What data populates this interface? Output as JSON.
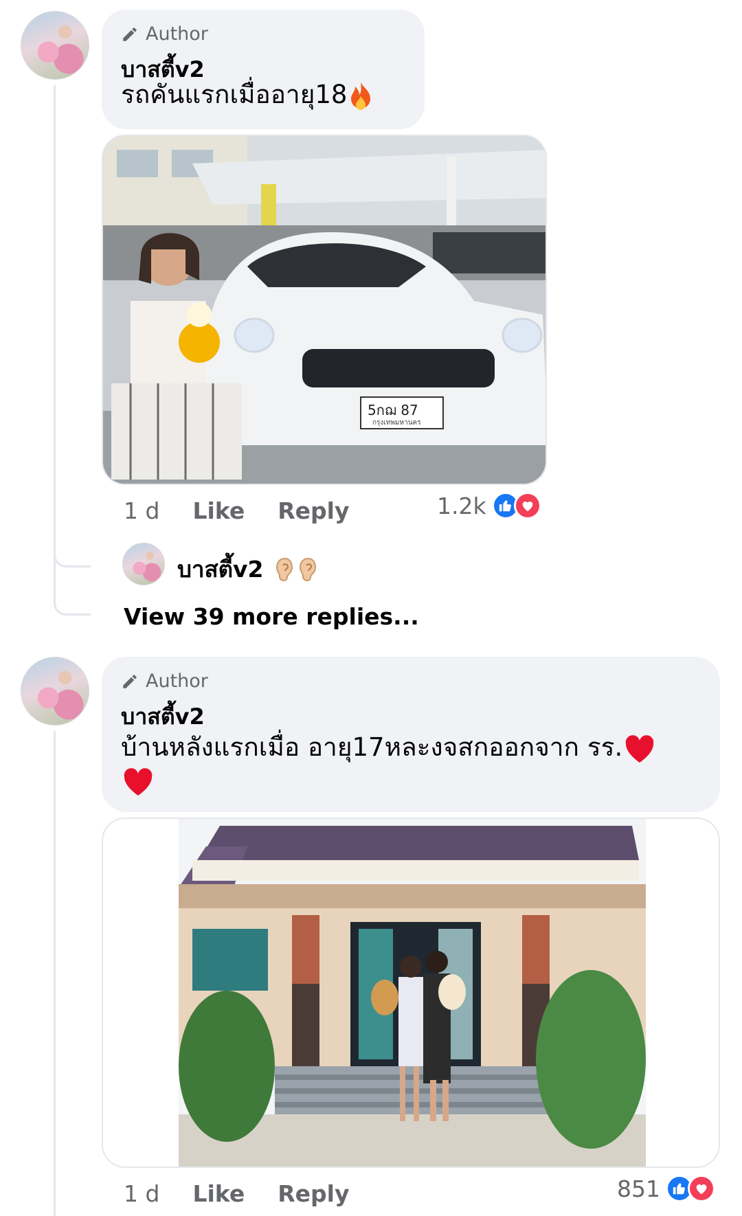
{
  "comments": [
    {
      "badge": "Author",
      "name": "บาสตี้v2",
      "text": "รถคันแรกเมื่ออายุ18",
      "text_emoji": "fire-emoji",
      "photo_plate": "5กฌ 87",
      "photo_plate_sub": "กรุงเทพมหานคร",
      "time": "1 d",
      "like_label": "Like",
      "reply_label": "Reply",
      "reaction_count": "1.2k"
    },
    {
      "badge": "Author",
      "name": "บาสตี้v2",
      "text": "บ้านหลังแรกเมื่อ อายุ17หละงจสกออกจาก รร.",
      "text_emoji": "heart-emoji",
      "time": "1 d",
      "like_label": "Like",
      "reply_label": "Reply",
      "reaction_count": "851"
    }
  ],
  "reply_preview": {
    "name": "บาสตี้v2",
    "emoji": "ear-emoji"
  },
  "view_more": "View 39 more replies...",
  "colors": {
    "bubble": "#f0f2f5",
    "secondary_text": "#65676b",
    "like_blue": "#1877f2",
    "love_red": "#f33e58"
  }
}
